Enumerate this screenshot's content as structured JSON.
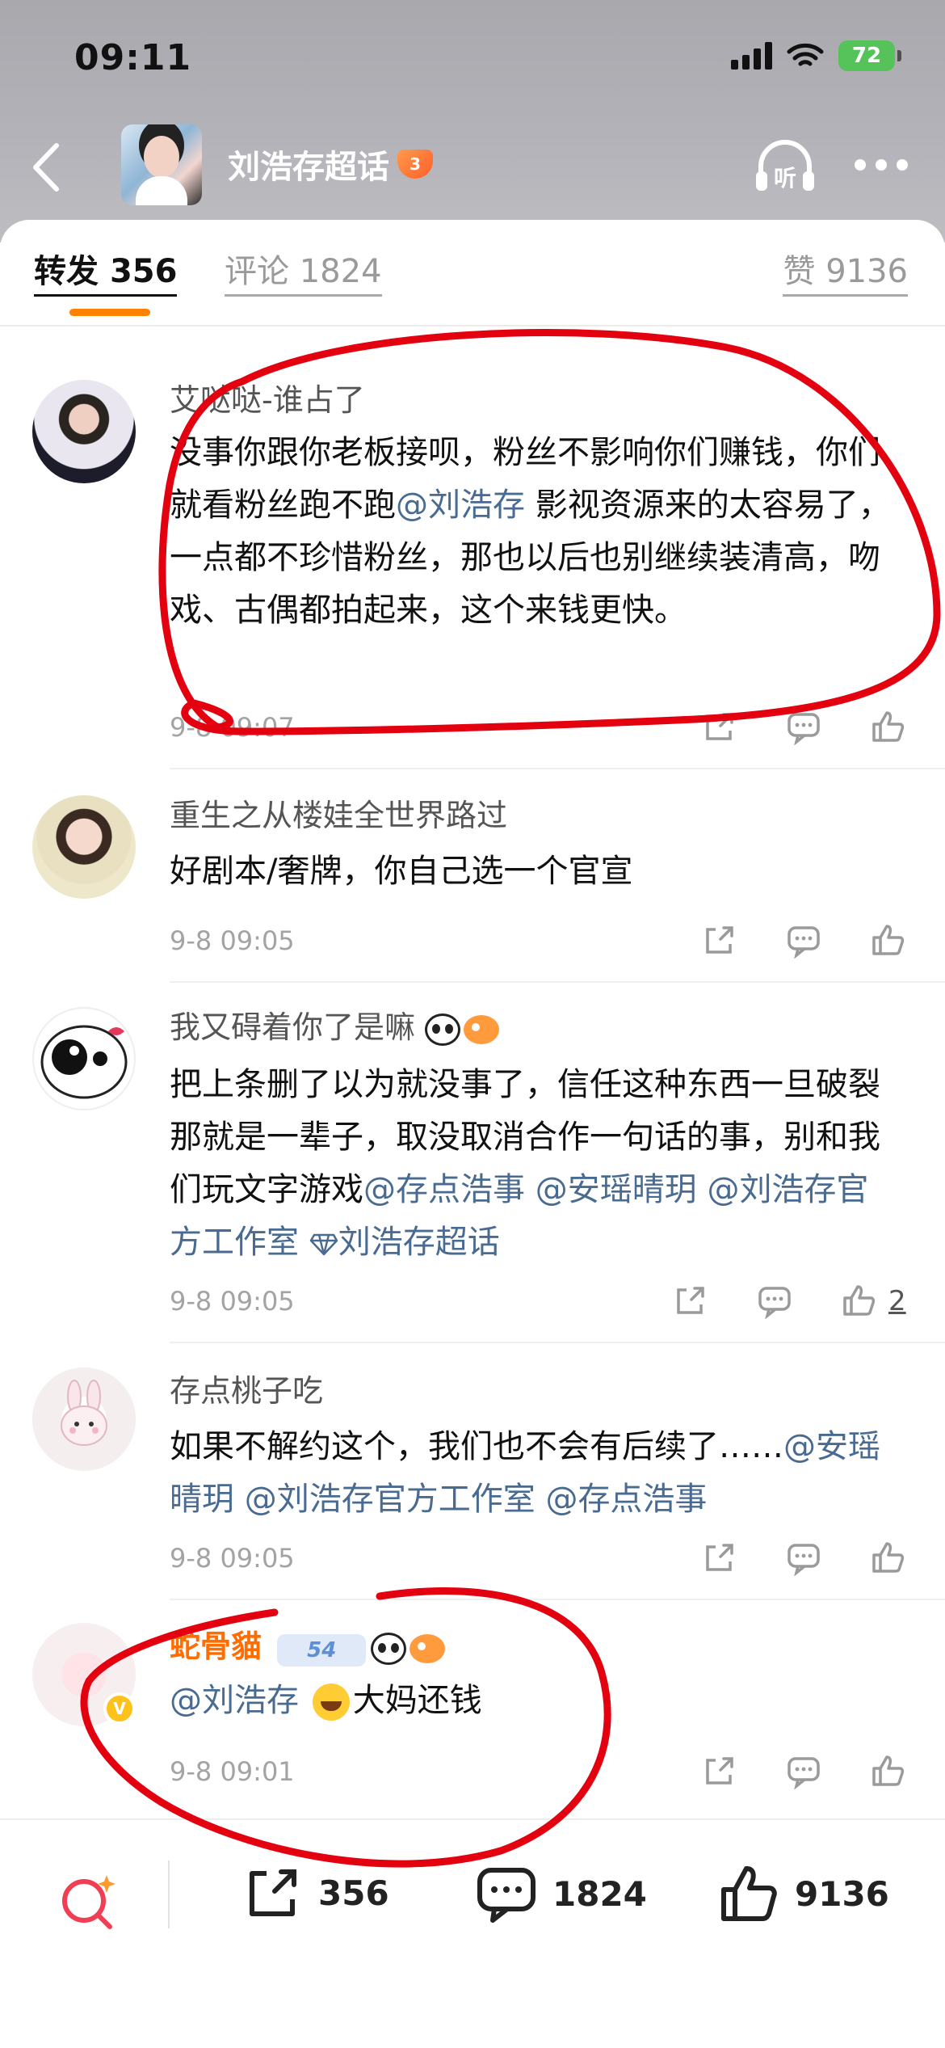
{
  "status_bar": {
    "time": "09:11",
    "battery": "72"
  },
  "header": {
    "topic_title": "刘浩存超话",
    "level_badge": "3"
  },
  "tabs": {
    "repost_label": "转发",
    "repost_count": "356",
    "comment_label": "评论",
    "comment_count": "1824",
    "like_label": "赞",
    "like_count": "9136"
  },
  "comments": [
    {
      "username": "艾哒哒-谁占了",
      "text_1": "没事你跟你老板接呗，粉丝不影响你们赚钱，你们就看粉丝跑不跑",
      "mention_1": "@刘浩存",
      "text_2": " 影视资源来的太容易了，一点都不珍惜粉丝，那也以后也别继续装清高，吻戏、古偶都拍起来，这个来钱更快。",
      "time": "9-8 09:07"
    },
    {
      "username": "重生之从楼娃全世界路过",
      "text_1": "好剧本/奢牌，你自己选一个官宣",
      "time": "9-8 09:05"
    },
    {
      "username": "我又碍着你了是嘛",
      "text_1": "把上条删了以为就没事了，信任这种东西一旦破裂那就是一辈子，取没取消合作一句话的事，别和我们玩文字游戏",
      "mention_1": "@存点浩事",
      "mention_2": "@安瑶晴玥",
      "mention_3": "@刘浩存官方工作室",
      "mention_4": "刘浩存超话",
      "time": "9-8 09:05",
      "likes": "2"
    },
    {
      "username": "存点桃子吃",
      "text_1": "如果不解约这个，我们也不会有后续了……",
      "mention_1": "@安瑶晴玥",
      "mention_2": "@刘浩存官方工作室",
      "mention_3": "@存点浩事",
      "time": "9-8 09:05"
    },
    {
      "username": "蛇骨貓",
      "fan_level": "54",
      "mention_1": "@刘浩存",
      "text_1": "大妈还钱",
      "time": "9-8 09:01"
    }
  ],
  "bottom_bar": {
    "repost_count": "356",
    "comment_count": "1824",
    "like_count": "9136"
  },
  "colors": {
    "accent": "#ff8200",
    "mention": "#4a6b91",
    "annotation": "#e3000f",
    "username_vip": "#ff6c00"
  }
}
